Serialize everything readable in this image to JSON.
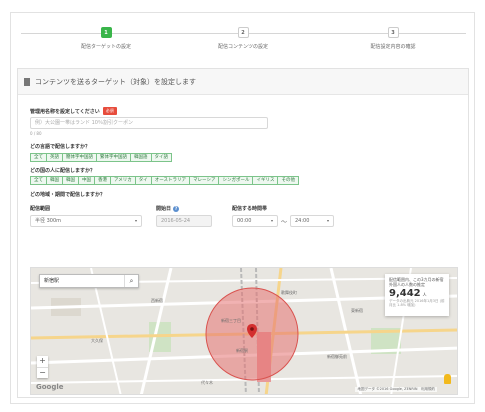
{
  "stepper": {
    "steps": [
      {
        "num": "1",
        "label": "配信ターゲットの設定",
        "active": true
      },
      {
        "num": "2",
        "label": "配信コンテンツの設定",
        "active": false
      },
      {
        "num": "3",
        "label": "配信設定内容の確認",
        "active": false
      }
    ]
  },
  "panel": {
    "title": "コンテンツを送るターゲット（対象）を設定します",
    "name_label": "管理用名称を設定してください",
    "required_badge": "必須",
    "name_placeholder": "例）大公園一帯はランド 10％割引クーポン",
    "name_count": "0 / 80",
    "language_label": "どの言語で配信しますか？",
    "languages": [
      "全て",
      "英語",
      "簡体字中国語",
      "繁体字中国語",
      "韓国語",
      "タイ語"
    ],
    "country_label": "どの国の人に配信しますか？",
    "countries": [
      "全て",
      "韓国",
      "韓国",
      "中国",
      "香港",
      "アメリカ",
      "タイ",
      "オーストラリア",
      "マレーシア",
      "シンガポール",
      "イギリス",
      "その他"
    ],
    "where_when_label": "どの地域・期間で配信しますか？",
    "range_label": "配信範囲",
    "range_value": "半径 300m",
    "date_label": "開始日",
    "date_value": "2016-05-24",
    "time_label": "配信する時間帯",
    "time_from": "00:00",
    "time_tilde": "〜",
    "time_to": "24:00"
  },
  "map": {
    "search_value": "新宿駅",
    "info_line1": "配信範囲内、この3カ月の新宿",
    "info_line2": "外国人の人数の推定",
    "info_number": "9,442",
    "info_unit": "人",
    "info_note": "データの出典元 2016年1月3日 (前月比 1.8% 増加)",
    "zoom_in": "+",
    "zoom_out": "−",
    "google": "Google",
    "attribution": "地図データ ©2016 Google, ZENRIN　利用規約",
    "labels": [
      "新宿三丁目",
      "新宿駅",
      "西新宿",
      "新宿御苑前",
      "代々木",
      "東新宿",
      "歌舞伎町",
      "大久保"
    ],
    "circle_color": "#e57373"
  },
  "colors": {
    "accent": "#39b54a",
    "required": "#e74c3c"
  }
}
